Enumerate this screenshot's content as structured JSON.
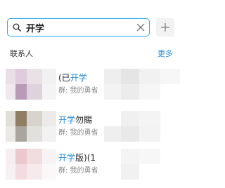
{
  "search": {
    "value": "开学",
    "placeholder": ""
  },
  "section": {
    "title": "联系人",
    "more": "更多"
  },
  "results": [
    {
      "prefix": "(已",
      "highlight": "开学",
      "suffix": "",
      "subtitle": "群: 我的勇省"
    },
    {
      "prefix": "",
      "highlight": "开学",
      "suffix": "勿賜",
      "subtitle": "群: 我的勇省"
    },
    {
      "prefix": "",
      "highlight": "开学",
      "suffix": "版)(1",
      "subtitle": "群: 我的勇省"
    }
  ],
  "colors": {
    "accent": "#2aa6e8",
    "link": "#2b8fd6"
  }
}
